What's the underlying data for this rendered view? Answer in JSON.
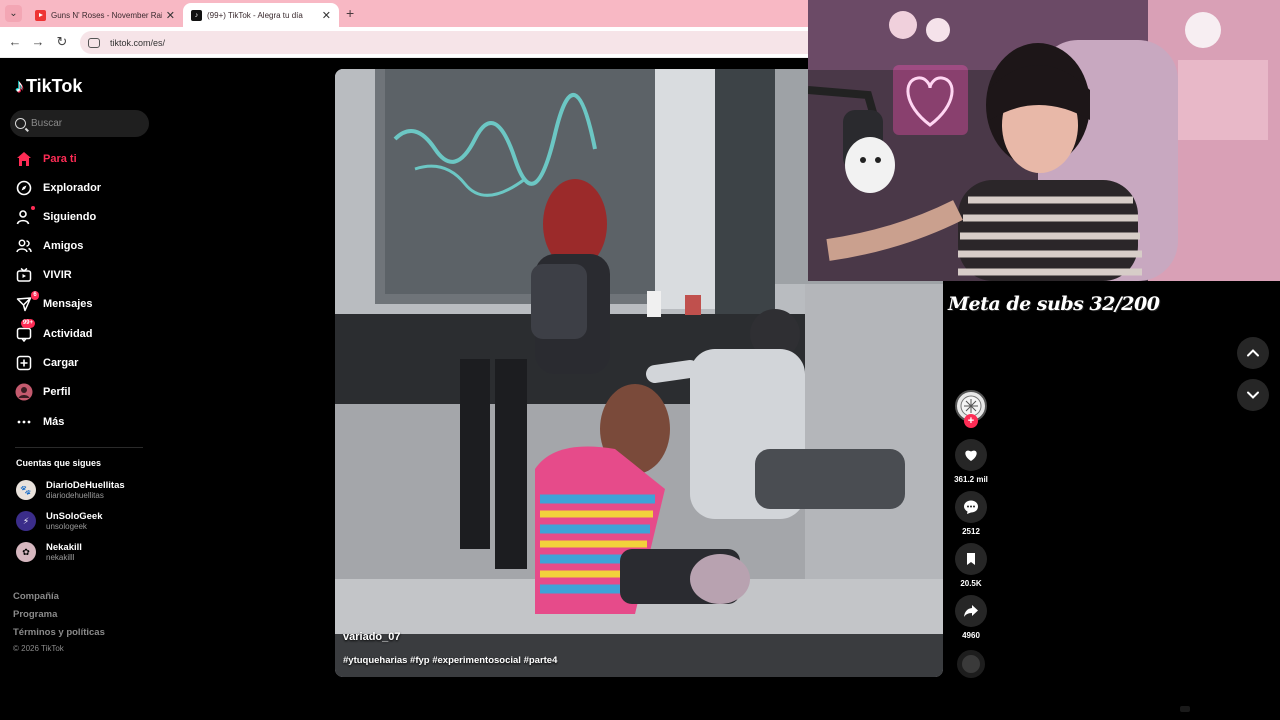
{
  "browser": {
    "tabs": [
      {
        "title": "Guns N' Roses - November Rain",
        "favicon": "youtube-icon",
        "active": false
      },
      {
        "title": "(99+) TikTok - Alegra tu día",
        "favicon": "tiktok-icon",
        "active": true
      }
    ],
    "new_tab_label": "+",
    "url": "tiktok.com/es/"
  },
  "sidebar": {
    "logo": "TikTok",
    "search_placeholder": "Buscar",
    "nav": [
      {
        "label": "Para ti",
        "icon": "home-icon",
        "active": true
      },
      {
        "label": "Explorador",
        "icon": "compass-icon"
      },
      {
        "label": "Siguiendo",
        "icon": "following-icon",
        "dot": true
      },
      {
        "label": "Amigos",
        "icon": "friends-icon"
      },
      {
        "label": "VIVIR",
        "icon": "live-icon"
      },
      {
        "label": "Mensajes",
        "icon": "messages-icon",
        "badge": "6"
      },
      {
        "label": "Actividad",
        "icon": "activity-icon",
        "badge": "99+"
      },
      {
        "label": "Cargar",
        "icon": "upload-icon"
      },
      {
        "label": "Perfil",
        "icon": "profile-avatar"
      },
      {
        "label": "Más",
        "icon": "more-icon"
      }
    ],
    "following_title": "Cuentas que sigues",
    "following": [
      {
        "name": "DiarioDeHuellitas",
        "handle": "diariodehuellitas"
      },
      {
        "name": "UnSoloGeek",
        "handle": "unsologeek"
      },
      {
        "name": "Nekakill",
        "handle": "nekakilll"
      }
    ],
    "footer_links": [
      "Compañía",
      "Programa",
      "Términos y políticas"
    ],
    "copyright": "© 2026 TikTok"
  },
  "video": {
    "author": "variado_07",
    "caption": "#ytuqueharias #fyp #experimentosocial #parte4"
  },
  "actions": {
    "likes": "361.2 mil",
    "comments": "2512",
    "saves": "20.5K",
    "shares": "4960"
  },
  "overlay": {
    "sub_goal": "Meta de subs 32/200"
  },
  "colors": {
    "accent": "#fe2c55",
    "tabbar": "#f8b8c4",
    "background": "#000000"
  }
}
